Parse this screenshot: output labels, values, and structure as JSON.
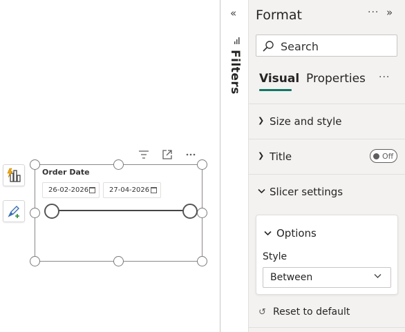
{
  "canvas": {
    "slicer": {
      "title": "Order Date",
      "start_date": "26-02-2026",
      "end_date": "27-04-2026"
    },
    "visual_header": {
      "icons": [
        "filter-icon",
        "focus-mode-icon",
        "more-options-icon"
      ]
    },
    "left_tools": [
      "build-visual-icon",
      "format-visual-icon"
    ]
  },
  "filters_pane": {
    "collapse_glyph": "«",
    "label": "Filters"
  },
  "format_pane": {
    "title": "Format",
    "more_glyph": "···",
    "expand_glyph": "»",
    "search": {
      "placeholder": "Search"
    },
    "tabs": [
      {
        "label": "Visual",
        "active": true
      },
      {
        "label": "Properties",
        "active": false
      }
    ],
    "tabs_more_glyph": "···",
    "sections": [
      {
        "label": "Size and style",
        "expanded": false
      },
      {
        "label": "Title",
        "expanded": false,
        "toggle": "Off"
      },
      {
        "label": "Slicer settings",
        "expanded": true
      }
    ],
    "options": {
      "label": "Options",
      "style_label": "Style",
      "style_value": "Between"
    },
    "reset_label": "Reset to default"
  },
  "colors": {
    "accent": "#117865",
    "pane_background": "#f3f2f1"
  }
}
